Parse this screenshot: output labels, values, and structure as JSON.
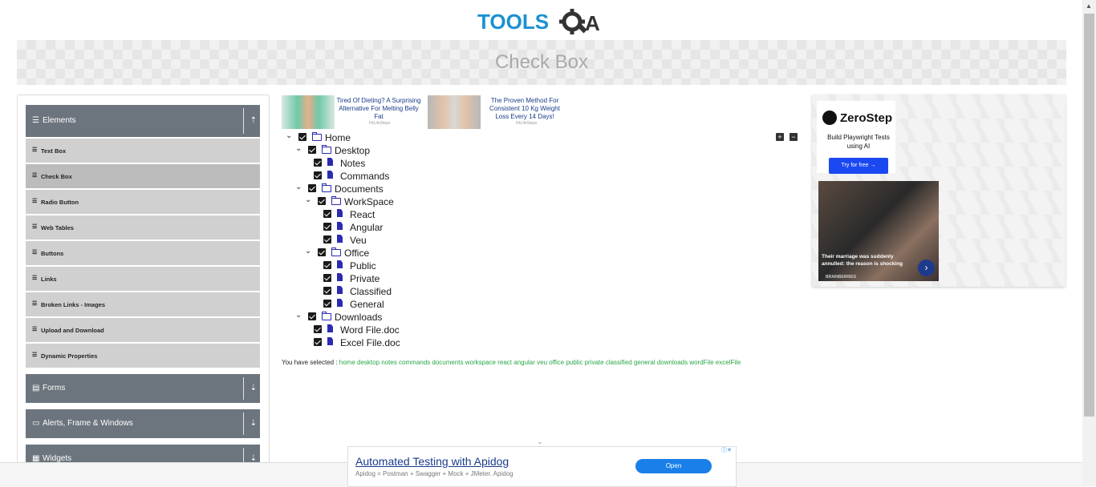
{
  "header": {
    "logo": "TOOLSQA",
    "page_title": "Check Box"
  },
  "sidebar": {
    "groups": [
      {
        "label": "Elements",
        "icon": "menu-icon"
      },
      {
        "label": "Forms",
        "icon": "document-icon"
      },
      {
        "label": "Alerts, Frame & Windows",
        "icon": "window-icon"
      },
      {
        "label": "Widgets",
        "icon": "widget-icon"
      }
    ],
    "items": [
      "Text Box",
      "Check Box",
      "Radio Button",
      "Web Tables",
      "Buttons",
      "Links",
      "Broken Links - Images",
      "Upload and Download",
      "Dynamic Properties"
    ],
    "active_item": "Check Box"
  },
  "top_ads": [
    {
      "text": "Tired Of Dieting? A Surprising Alternative For Melting Belly Fat",
      "source": "FitLifeSteps"
    },
    {
      "text": "The Proven Method For Consistent 10 Kg Weight Loss Every 14 Days!",
      "source": "FitLifeSteps"
    }
  ],
  "tree": {
    "home": "Home",
    "desktop": "Desktop",
    "notes": "Notes",
    "commands": "Commands",
    "documents": "Documents",
    "workspace": "WorkSpace",
    "react": "React",
    "angular": "Angular",
    "veu": "Veu",
    "office": "Office",
    "public": "Public",
    "private": "Private",
    "classified": "Classified",
    "general": "General",
    "downloads": "Downloads",
    "word": "Word File.doc",
    "excel": "Excel File.doc",
    "expand_all": "+",
    "collapse_all": "−"
  },
  "result": {
    "label": "You have selected :",
    "values": "home desktop notes commands documents workspace react angular veu office public private classified general downloads wordFile excelFile"
  },
  "right_ad": {
    "brand": "ZeroStep",
    "tagline": "Build Playwright Tests using AI",
    "cta": "Try for free →",
    "story_caption": "Their marriage was suddenly annulled: the reason is shocking",
    "story_source": "BRAINBERRIES"
  },
  "bottom_ad": {
    "title": "Automated Testing with Apidog",
    "subtitle": "Apidog = Postman + Swagger + Mock + JMeter. Apidog",
    "cta": "Open"
  },
  "colors": {
    "accent_blue": "#1a91d1",
    "sidebar_header": "#6c757d",
    "selected_green": "#28a745"
  }
}
